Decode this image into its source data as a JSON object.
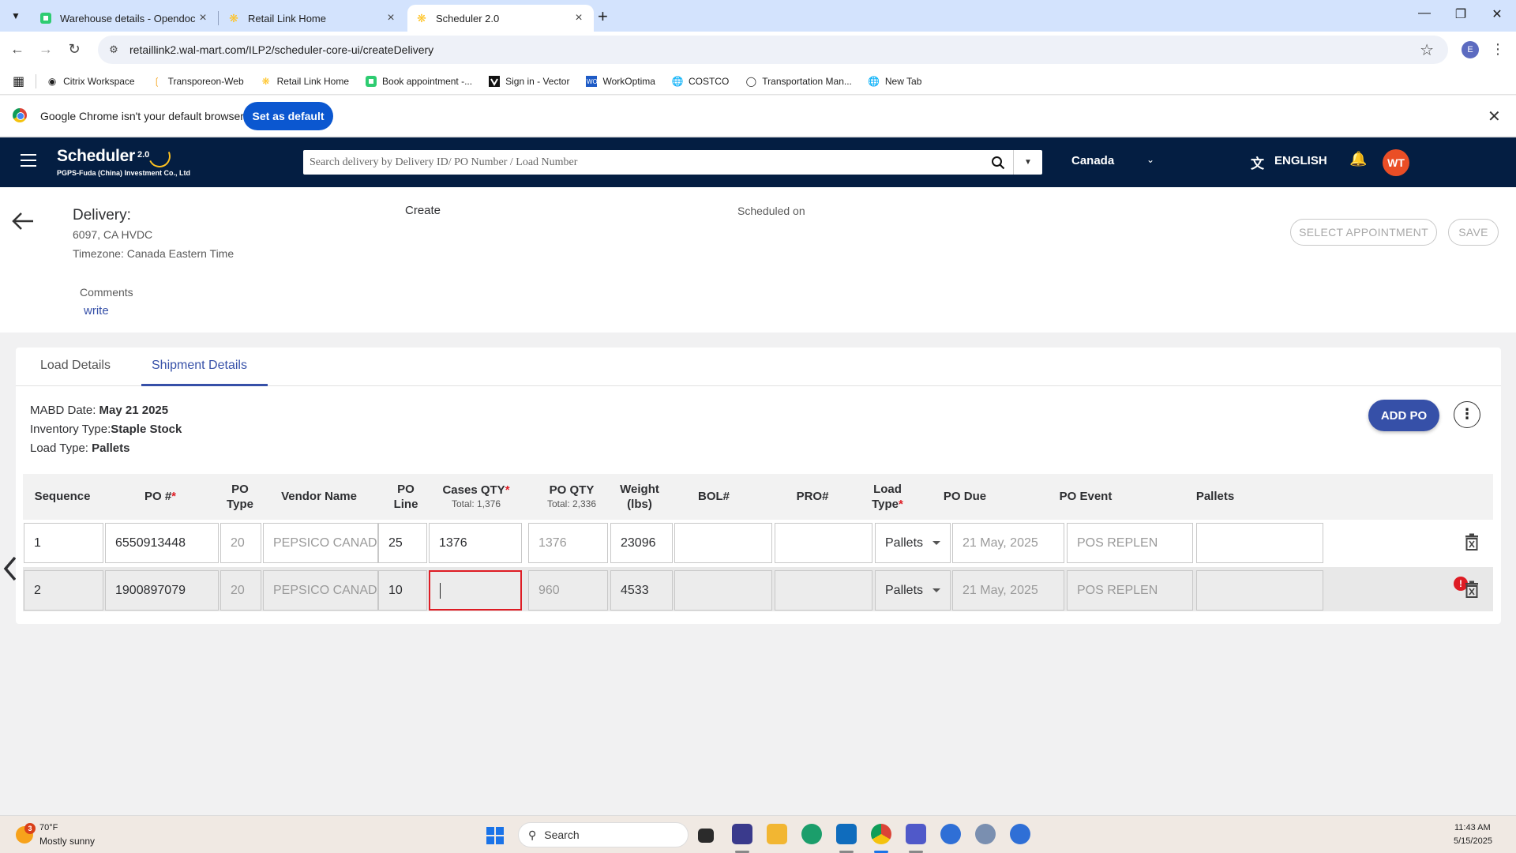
{
  "browser": {
    "tabs": [
      {
        "title": "Warehouse details - Opendock",
        "icon": "opendock-icon"
      },
      {
        "title": "Retail Link Home",
        "icon": "walmart-spark-icon"
      },
      {
        "title": "Scheduler 2.0",
        "icon": "walmart-spark-icon",
        "active": true
      }
    ],
    "url": "retaillink2.wal-mart.com/ILP2/scheduler-core-ui/createDelivery",
    "profile_initial": "E",
    "bookmarks": [
      {
        "label": "Citrix Workspace",
        "icon": "citrix-icon"
      },
      {
        "label": "Transporeon-Web",
        "icon": "transporeon-icon"
      },
      {
        "label": "Retail Link Home",
        "icon": "walmart-spark-icon"
      },
      {
        "label": "Book appointment -...",
        "icon": "opendock-icon"
      },
      {
        "label": "Sign in - Vector",
        "icon": "vector-icon"
      },
      {
        "label": "WorkOptima",
        "icon": "workoptima-icon"
      },
      {
        "label": "COSTCO",
        "icon": "globe-icon"
      },
      {
        "label": "Transportation Man...",
        "icon": "transportation-icon"
      },
      {
        "label": "New Tab",
        "icon": "globe-icon"
      }
    ],
    "infobar": {
      "message": "Google Chrome isn't your default browser",
      "button": "Set as default"
    }
  },
  "app": {
    "title": "Scheduler",
    "version": "2.0",
    "company": "PGPS-Fuda (China) Investment Co., Ltd",
    "search_placeholder": "Search delivery by Delivery ID/ PO Number / Load Number",
    "country": "Canada",
    "language": "ENGLISH",
    "user_initials": "WT",
    "accent_color": "#3650a8",
    "header_color": "#041e42"
  },
  "delivery": {
    "title": "Delivery:",
    "location": "6097, CA HVDC",
    "timezone": "Timezone: Canada Eastern Time",
    "mode": "Create",
    "scheduled_label": "Scheduled on",
    "select_appointment": "SELECT APPOINTMENT",
    "save": "SAVE",
    "comments_label": "Comments",
    "comments_link": "write"
  },
  "shipment": {
    "tabs": [
      "Load Details",
      "Shipment Details"
    ],
    "active_tab": "Shipment Details",
    "mabd_label": "MABD Date:",
    "mabd_value": "May 21 2025",
    "inventory_label": "Inventory Type:",
    "inventory_value": "Staple Stock",
    "load_label": "Load Type:",
    "load_value": "Pallets",
    "add_po": "ADD PO",
    "columns": {
      "sequence": "Sequence",
      "po_number": "PO #",
      "po_type_1": "PO",
      "po_type_2": "Type",
      "vendor": "Vendor Name",
      "po_line_1": "PO",
      "po_line_2": "Line",
      "cases_qty": "Cases QTY",
      "cases_total": "Total: 1,376",
      "po_qty": "PO QTY",
      "po_total": "Total: 2,336",
      "weight_1": "Weight",
      "weight_2": "(lbs)",
      "bol": "BOL#",
      "pro": "PRO#",
      "load_type_1": "Load",
      "load_type_2": "Type",
      "po_due": "PO Due",
      "po_event": "PO Event",
      "pallets": "Pallets",
      "required_mark": "*"
    },
    "rows": [
      {
        "sequence": "1",
        "po": "6550913448",
        "po_type": "20",
        "vendor": "PEPSICO CANADA U",
        "po_line": "25",
        "cases_qty": "1376",
        "po_qty": "1376",
        "weight": "23096",
        "bol": "",
        "pro": "",
        "load_type": "Pallets",
        "po_due": "21 May, 2025",
        "po_event": "POS REPLEN",
        "pallets": ""
      },
      {
        "sequence": "2",
        "po": "1900897079",
        "po_type": "20",
        "vendor": "PEPSICO CANADA U",
        "po_line": "10",
        "cases_qty": "",
        "po_qty": "960",
        "weight": "4533",
        "bol": "",
        "pro": "",
        "load_type": "Pallets",
        "po_due": "21 May, 2025",
        "po_event": "POS REPLEN",
        "pallets": "",
        "error": true
      }
    ]
  },
  "taskbar": {
    "temperature": "70°F",
    "weather": "Mostly sunny",
    "weather_badge": "3",
    "search": "Search",
    "time": "11:43 AM",
    "date": "5/15/2025"
  }
}
